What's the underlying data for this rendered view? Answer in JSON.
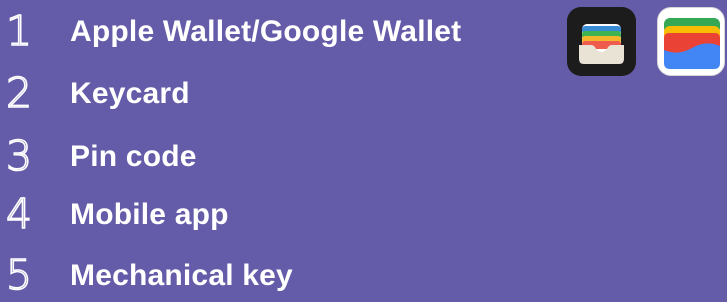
{
  "options": [
    {
      "number": "1",
      "label": "Apple Wallet/Google Wallet"
    },
    {
      "number": "2",
      "label": "Keycard"
    },
    {
      "number": "3",
      "label": "Pin code"
    },
    {
      "number": "4",
      "label": "Mobile app"
    },
    {
      "number": "5",
      "label": "Mechanical key"
    }
  ],
  "icons": {
    "apple_wallet": "apple-wallet-icon",
    "google_wallet": "google-wallet-icon"
  },
  "colors": {
    "background": "#645ca8",
    "text": "#ffffff"
  }
}
